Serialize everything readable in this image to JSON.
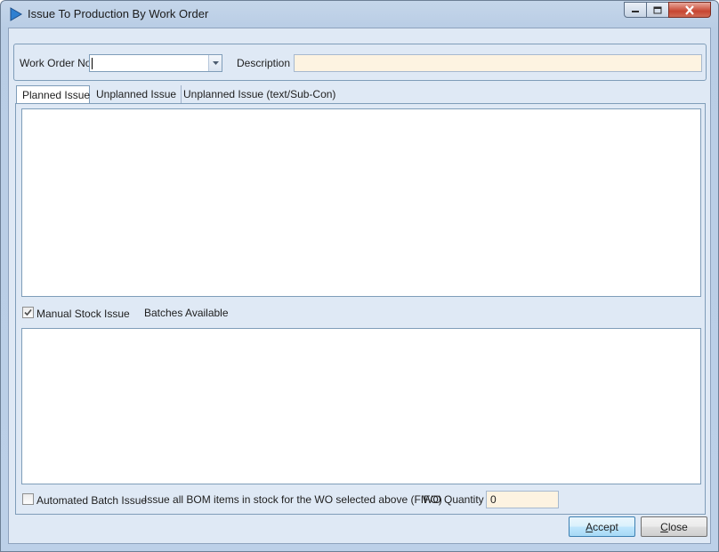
{
  "window": {
    "title": "Issue To Production By Work Order"
  },
  "header": {
    "work_order_label": "Work Order No",
    "work_order_value": "",
    "description_label": "Description",
    "description_value": ""
  },
  "tabs": [
    {
      "label": "Planned Issue",
      "active": true
    },
    {
      "label": "Unplanned Issue",
      "active": false
    },
    {
      "label": "Unplanned Issue (text/Sub-Con)",
      "active": false
    }
  ],
  "manual_stock": {
    "label": "Manual Stock Issue",
    "checked": true,
    "batches_label": "Batches Available"
  },
  "automated": {
    "label": "Automated Batch Issue",
    "checked": false,
    "hint": "Issue all BOM items in stock for the WO selected above (FIFO)",
    "qty_label": "WO Quantity",
    "qty_value": "0"
  },
  "buttons": {
    "accept_first": "A",
    "accept_rest": "ccept",
    "close_first": "C",
    "close_rest": "lose"
  },
  "colors": {
    "accent": "#3c7fb1",
    "field_bg": "#fdf3e1",
    "panel_bg": "#dfe9f5"
  }
}
